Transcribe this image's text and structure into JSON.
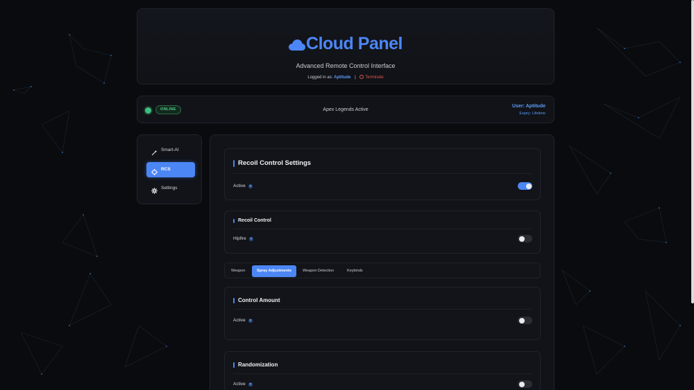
{
  "header": {
    "brand": "Cloud Panel",
    "subtitle": "Advanced Remote Control Interface",
    "logged_prefix": "Logged in as:",
    "logged_user": "Aptitude",
    "separator": "|",
    "terminate": "Terminate"
  },
  "status": {
    "badge": "ONLINE",
    "game": "Apex Legends Active",
    "user": "User: Aptitude",
    "expiry": "Expiry: Lifetime"
  },
  "sidebar": {
    "items": [
      {
        "label": "Smart-AI",
        "icon": "magic-wand-icon",
        "active": false
      },
      {
        "label": "RCS",
        "icon": "crosshair-icon",
        "active": true
      },
      {
        "label": "Settings",
        "icon": "gear-icon",
        "active": false
      }
    ]
  },
  "main": {
    "recoil_settings": {
      "title": "Recoil Control Settings",
      "active_label": "Active",
      "active_on": true
    },
    "recoil_control": {
      "title": "Recoil Control",
      "hipfire_label": "Hipfire",
      "hipfire_on": false
    },
    "tabs": [
      {
        "label": "Weapon",
        "active": false
      },
      {
        "label": "Spray Adjustments",
        "active": true
      },
      {
        "label": "Weapon Detection",
        "active": false
      },
      {
        "label": "Keybinds",
        "active": false
      }
    ],
    "control_amount": {
      "title": "Control Amount",
      "active_label": "Active",
      "active_on": false
    },
    "randomization": {
      "title": "Randomization",
      "active_label": "Active",
      "active_on": false
    }
  },
  "help_glyph": "?",
  "colors": {
    "accent": "#4c86f5",
    "online": "#3fbf7f",
    "danger": "#e0554e",
    "background": "#0a0b0e"
  }
}
